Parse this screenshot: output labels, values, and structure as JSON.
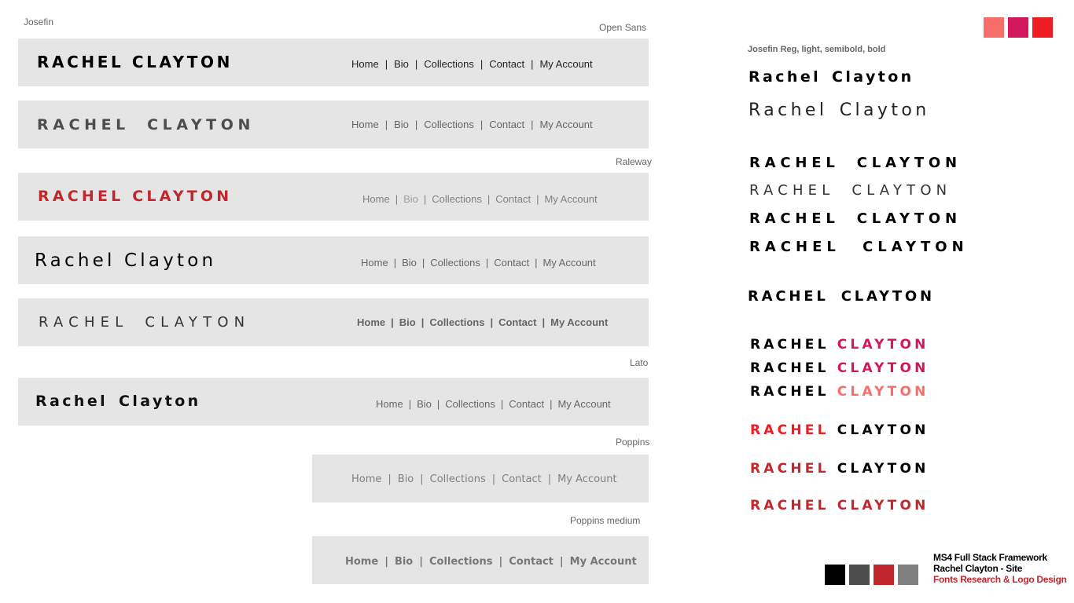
{
  "labels": {
    "josefin": "Josefin",
    "open_sans": "Open Sans",
    "raleway": "Raleway",
    "lato": "Lato",
    "poppins": "Poppins",
    "poppins_medium": "Poppins medium",
    "josefin_weights": "Josefin Reg, light, semibold, bold"
  },
  "nav": {
    "home": "Home",
    "bio": "Bio",
    "collections": "Collections",
    "contact": "Contact",
    "account": "My Account",
    "sep": "|"
  },
  "logo": {
    "upper_first": "RACHEL",
    "upper_last": "CLAYTON",
    "upper_full": "RACHEL CLAYTON",
    "title_full": "Rachel Clayton",
    "title_first": "Rachel",
    "title_last": "Clayton"
  },
  "footer": {
    "line1": "MS4 Full Stack Framework",
    "line2": "Rachel Clayton - Site",
    "line3": "Fonts Research & Logo Design"
  },
  "colors": {
    "accent_salmon": "#f76d6a",
    "accent_magenta": "#d3175e",
    "accent_red": "#ee1c23",
    "black": "#000000",
    "dark_grey": "#4d4d4d",
    "brand_red": "#c1272d",
    "grey": "#808080",
    "bar_bg": "#e5e5e5"
  },
  "icons": [
    "color-swatch"
  ]
}
